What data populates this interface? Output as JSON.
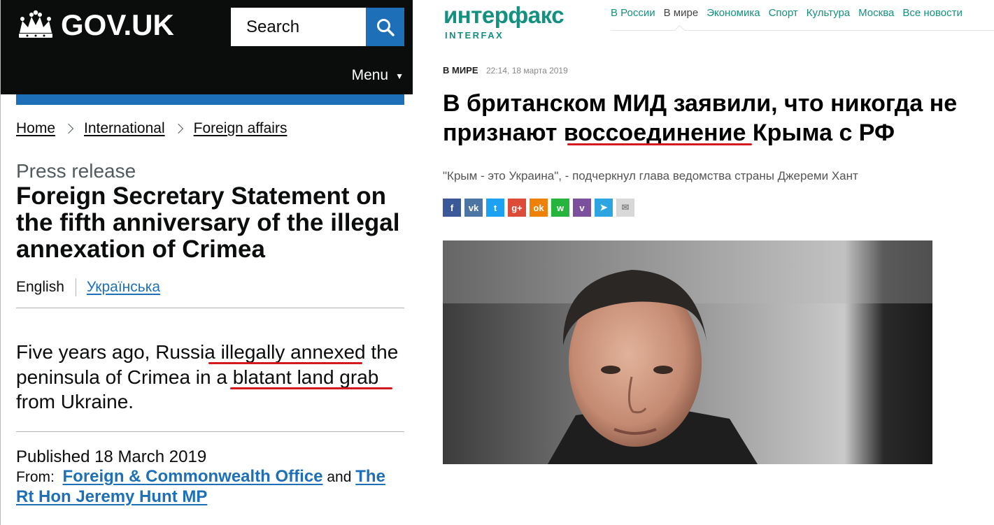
{
  "gov": {
    "logo_text": "GOV.UK",
    "search": {
      "placeholder": "Search"
    },
    "menu_label": "Menu",
    "breadcrumbs": [
      "Home",
      "International",
      "Foreign affairs"
    ],
    "doc_type": "Press release",
    "title": "Foreign Secretary Statement on the fifth anniversary of the illegal annexation of Crimea",
    "languages": {
      "current": "English",
      "alternate": "Українська"
    },
    "lede": {
      "part1": "Five years ago, Russia ",
      "highlight1": "illegally annexed",
      "part2": " the peninsula of Crimea in a ",
      "highlight2": "blatant land grab",
      "part3": " from Ukraine."
    },
    "published": "Published 18 March 2019",
    "from": {
      "label": "From:",
      "org": "Foreign & Commonwealth Office",
      "and": "and",
      "person": "The Rt Hon Jeremy Hunt MP"
    },
    "colors": {
      "header": "#0b0c0c",
      "link": "#1d70b8",
      "highlight_underline": "#d4191f"
    }
  },
  "ifx": {
    "logo_main": "интерфакс",
    "logo_sub": "INTERFAX",
    "nav": [
      "В России",
      "В мире",
      "Экономика",
      "Спорт",
      "Культура",
      "Москва",
      "Все новости"
    ],
    "nav_active": "В мире",
    "rubric": "В МИРЕ",
    "date": "22:14, 18 марта 2019",
    "title": {
      "part1": "В британском МИД заявили, что никогда не признают ",
      "highlight": "воссоединение",
      "part2": " Крыма с РФ"
    },
    "lead": "\"Крым - это Украина\", - подчеркнул глава ведомства страны Джереми Хант",
    "share": [
      {
        "name": "facebook-icon",
        "glyph": "f",
        "color": "#3b5998"
      },
      {
        "name": "vk-icon",
        "glyph": "vk",
        "color": "#4c75a3"
      },
      {
        "name": "twitter-icon",
        "glyph": "t",
        "color": "#1da1f2"
      },
      {
        "name": "google-plus-icon",
        "glyph": "g+",
        "color": "#dd4b39"
      },
      {
        "name": "odnoklassniki-icon",
        "glyph": "ok",
        "color": "#ee8208"
      },
      {
        "name": "whatsapp-icon",
        "glyph": "w",
        "color": "#25b43c"
      },
      {
        "name": "viber-icon",
        "glyph": "v",
        "color": "#7b519d"
      },
      {
        "name": "telegram-icon",
        "glyph": "➤",
        "color": "#2ca5e0"
      },
      {
        "name": "email-icon",
        "glyph": "✉",
        "color": "#d8d8d8"
      }
    ],
    "colors": {
      "brand": "#13907f",
      "highlight_underline": "#d4191f"
    }
  }
}
